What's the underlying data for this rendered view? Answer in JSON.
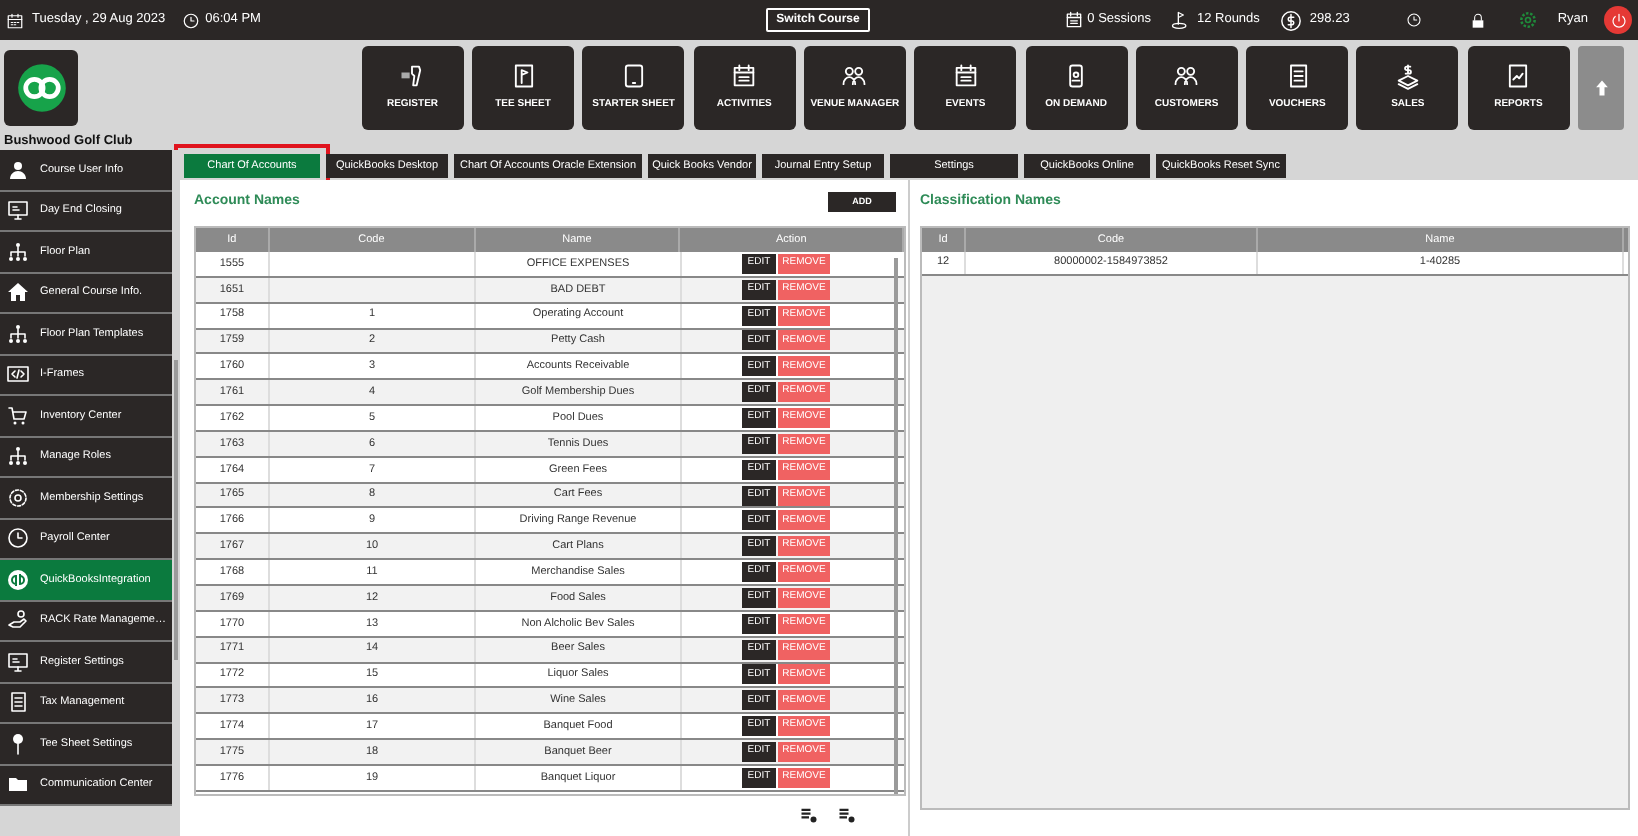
{
  "top_bar": {
    "date": "Tuesday , 29 Aug 2023",
    "time": "06:04 PM",
    "switch_button": "Switch Course",
    "sessions": "0 Sessions",
    "rounds": "12 Rounds",
    "balance": "298.23",
    "user": "Ryan"
  },
  "club": {
    "name": "Bushwood Golf Club"
  },
  "nav_tiles": [
    {
      "label": "REGISTER",
      "kind": "scanner"
    },
    {
      "label": "TEE SHEET",
      "kind": "flag"
    },
    {
      "label": "STARTER SHEET",
      "kind": "tablet"
    },
    {
      "label": "ACTIVITIES",
      "kind": "calendar"
    },
    {
      "label": "VENUE MANAGER",
      "kind": "people"
    },
    {
      "label": "EVENTS",
      "kind": "calendar"
    },
    {
      "label": "ON DEMAND",
      "kind": "phone"
    },
    {
      "label": "CUSTOMERS",
      "kind": "people"
    },
    {
      "label": "VOUCHERS",
      "kind": "doc"
    },
    {
      "label": "SALES",
      "kind": "money"
    },
    {
      "label": "REPORTS",
      "kind": "chart"
    }
  ],
  "sidebar": {
    "items": [
      {
        "label": "Course User Info",
        "kind": "person",
        "selected": false
      },
      {
        "label": "Day End Closing",
        "kind": "monitor",
        "selected": false
      },
      {
        "label": "Floor Plan",
        "kind": "org",
        "selected": false
      },
      {
        "label": "General Course Info.",
        "kind": "house",
        "selected": false
      },
      {
        "label": "Floor Plan Templates",
        "kind": "org",
        "selected": false
      },
      {
        "label": "I-Frames",
        "kind": "code",
        "selected": false
      },
      {
        "label": "Inventory Center",
        "kind": "cart",
        "selected": false
      },
      {
        "label": "Manage Roles",
        "kind": "org",
        "selected": false
      },
      {
        "label": "Membership Settings",
        "kind": "gear",
        "selected": false
      },
      {
        "label": "Payroll Center",
        "kind": "clock",
        "selected": false
      },
      {
        "label": "QuickBooksIntegration",
        "kind": "qb",
        "selected": true
      },
      {
        "label": "RACK Rate Manageme…",
        "kind": "hand",
        "selected": false
      },
      {
        "label": "Register Settings",
        "kind": "monitor",
        "selected": false
      },
      {
        "label": "Tax Management",
        "kind": "doc",
        "selected": false
      },
      {
        "label": "Tee Sheet Settings",
        "kind": "tee",
        "selected": false
      },
      {
        "label": "Communication Center",
        "kind": "folder",
        "selected": false
      }
    ]
  },
  "tabs": [
    {
      "label": "Chart Of Accounts",
      "selected": true
    },
    {
      "label": "QuickBooks Desktop",
      "selected": false
    },
    {
      "label": "Chart Of Accounts Oracle Extension",
      "selected": false
    },
    {
      "label": "Quick Books Vendor",
      "selected": false
    },
    {
      "label": "Journal Entry Setup",
      "selected": false
    },
    {
      "label": "Settings",
      "selected": false
    },
    {
      "label": "QuickBooks Online",
      "selected": false
    },
    {
      "label": "QuickBooks Reset Sync",
      "selected": false
    }
  ],
  "account_panel": {
    "title": "Account Names",
    "add_button": "ADD",
    "columns": [
      "Id",
      "Code",
      "Name",
      "Action"
    ],
    "rows": [
      {
        "id": "1555",
        "name": "OFFICE EXPENSES",
        "edit": "EDIT",
        "remove": "REMOVE"
      },
      {
        "id": "1651",
        "name": "BAD DEBT",
        "edit": "EDIT",
        "remove": "REMOVE"
      },
      {
        "id": "1758",
        "code": "1",
        "name": "Operating Account",
        "edit": "EDIT",
        "remove": "REMOVE"
      },
      {
        "id": "1759",
        "code": "2",
        "name": "Petty Cash",
        "edit": "EDIT",
        "remove": "REMOVE"
      },
      {
        "id": "1760",
        "code": "3",
        "name": "Accounts Receivable",
        "edit": "EDIT",
        "remove": "REMOVE"
      },
      {
        "id": "1761",
        "code": "4",
        "name": "Golf Membership Dues",
        "edit": "EDIT",
        "remove": "REMOVE"
      },
      {
        "id": "1762",
        "code": "5",
        "name": "Pool Dues",
        "edit": "EDIT",
        "remove": "REMOVE"
      },
      {
        "id": "1763",
        "code": "6",
        "name": "Tennis Dues",
        "edit": "EDIT",
        "remove": "REMOVE"
      },
      {
        "id": "1764",
        "code": "7",
        "name": "Green Fees",
        "edit": "EDIT",
        "remove": "REMOVE"
      },
      {
        "id": "1765",
        "code": "8",
        "name": "Cart Fees",
        "edit": "EDIT",
        "remove": "REMOVE"
      },
      {
        "id": "1766",
        "code": "9",
        "name": "Driving Range Revenue",
        "edit": "EDIT",
        "remove": "REMOVE"
      },
      {
        "id": "1767",
        "code": "10",
        "name": "Cart Plans",
        "edit": "EDIT",
        "remove": "REMOVE"
      },
      {
        "id": "1768",
        "code": "11",
        "name": "Merchandise Sales",
        "edit": "EDIT",
        "remove": "REMOVE"
      },
      {
        "id": "1769",
        "code": "12",
        "name": "Food Sales",
        "edit": "EDIT",
        "remove": "REMOVE"
      },
      {
        "id": "1770",
        "code": "13",
        "name": "Non Alcholic Bev Sales",
        "edit": "EDIT",
        "remove": "REMOVE"
      },
      {
        "id": "1771",
        "code": "14",
        "name": "Beer Sales",
        "edit": "EDIT",
        "remove": "REMOVE"
      },
      {
        "id": "1772",
        "code": "15",
        "name": "Liquor Sales",
        "edit": "EDIT",
        "remove": "REMOVE"
      },
      {
        "id": "1773",
        "code": "16",
        "name": "Wine Sales",
        "edit": "EDIT",
        "remove": "REMOVE"
      },
      {
        "id": "1774",
        "code": "17",
        "name": "Banquet Food",
        "edit": "EDIT",
        "remove": "REMOVE"
      },
      {
        "id": "1775",
        "code": "18",
        "name": "Banquet Beer",
        "edit": "EDIT",
        "remove": "REMOVE"
      },
      {
        "id": "1776",
        "code": "19",
        "name": "Banquet Liquor",
        "edit": "EDIT",
        "remove": "REMOVE"
      }
    ]
  },
  "classification_panel": {
    "title": "Classification Names",
    "columns": [
      "Id",
      "Code",
      "Name"
    ],
    "rows": [
      {
        "id": "12",
        "code": "80000002-1584973852",
        "name": "1-40285"
      }
    ]
  }
}
